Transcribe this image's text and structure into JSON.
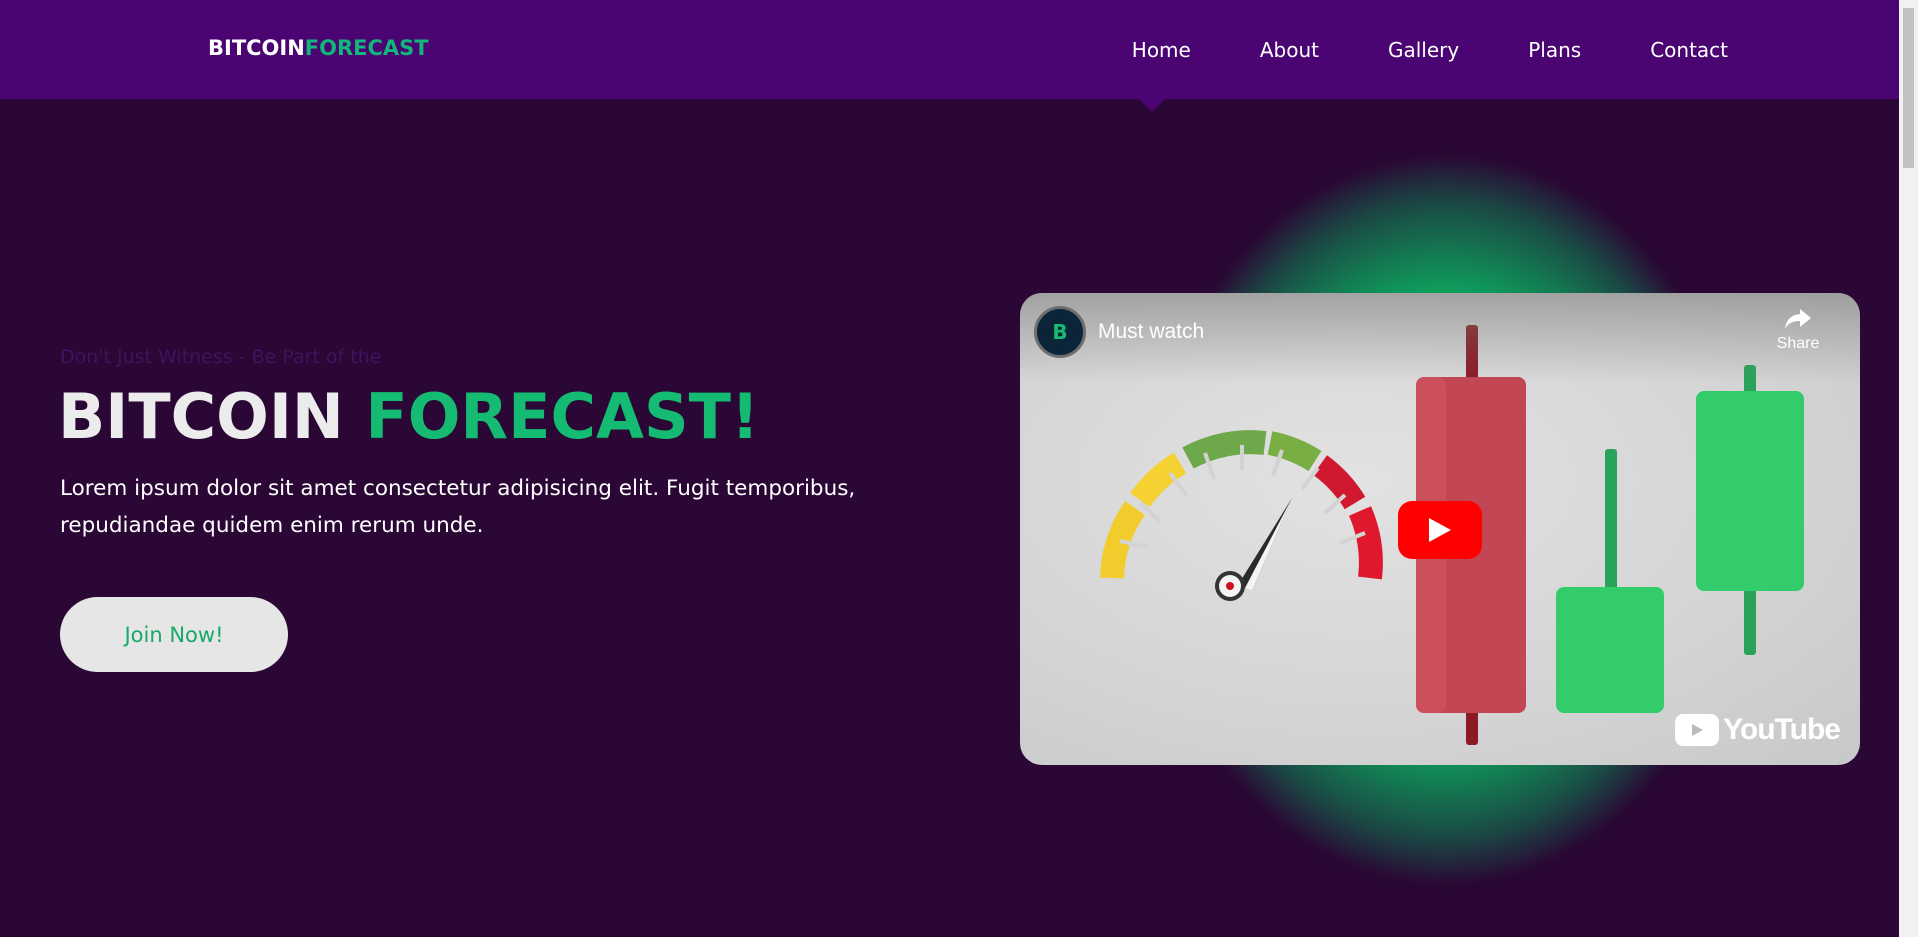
{
  "header": {
    "brand_part1": "BITCOIN",
    "brand_part2": "FORECAST",
    "nav": [
      "Home",
      "About",
      "Gallery",
      "Plans",
      "Contact"
    ],
    "active_nav": "Home"
  },
  "hero": {
    "eyebrow": "Don't Just Witness - Be Part of the",
    "title_part1": "BITCOIN ",
    "title_part2": "FORECAST!",
    "description": "Lorem ipsum dolor sit amet consectetur adipisicing elit. Fugit temporibus, repudiandae quidem enim rerum unde.",
    "cta_label": "Join Now!"
  },
  "video": {
    "title": "Must watch",
    "share_label": "Share",
    "channel_avatar_letter": "B",
    "platform_label": "YouTube",
    "play_icon": "play-icon",
    "share_icon": "share-arrow-icon"
  },
  "colors": {
    "background": "#2a0734",
    "header": "#4a0572",
    "accent_green": "#15bb72",
    "button_bg": "#e6e6e6"
  }
}
